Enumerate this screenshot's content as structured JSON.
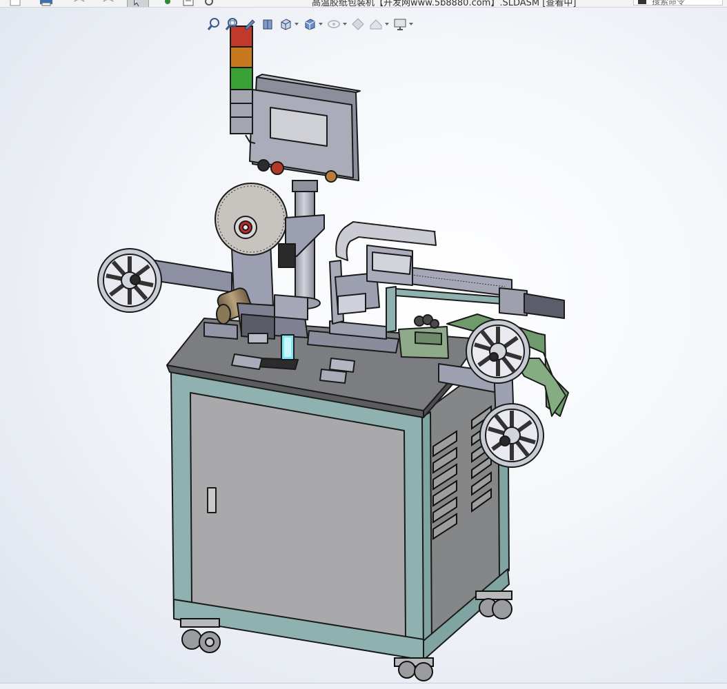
{
  "window": {
    "title": "高温胶纸包装机【开发网www.5b8880.com】.SLDASM [查看中]"
  },
  "search": {
    "placeholder": "搜索命令"
  },
  "toolbar_top": {
    "icons": [
      "new-document-icon",
      "print-icon",
      "undo-icon",
      "redo-icon",
      "select-pointer-icon",
      "traffic-light-icon",
      "file-properties-icon",
      "options-gear-icon"
    ]
  },
  "heads_up_toolbar": {
    "icons": [
      "zoom-to-fit-icon",
      "zoom-to-area-icon",
      "previous-view-icon",
      "section-view-icon",
      "view-orientation-icon",
      "display-style-icon",
      "hide-show-items-icon",
      "edit-appearance-icon",
      "apply-scene-icon",
      "view-settings-icon"
    ]
  },
  "colors": {
    "frame_teal": "#8fb2b0",
    "panel_gray": "#a9a9ab",
    "top_plate": "#7c7d80",
    "metal": "#b6b8c4",
    "tape_green": "#6f9a6c",
    "light_red": "#c0392b",
    "light_orange": "#c8791d",
    "light_green": "#39a136"
  }
}
